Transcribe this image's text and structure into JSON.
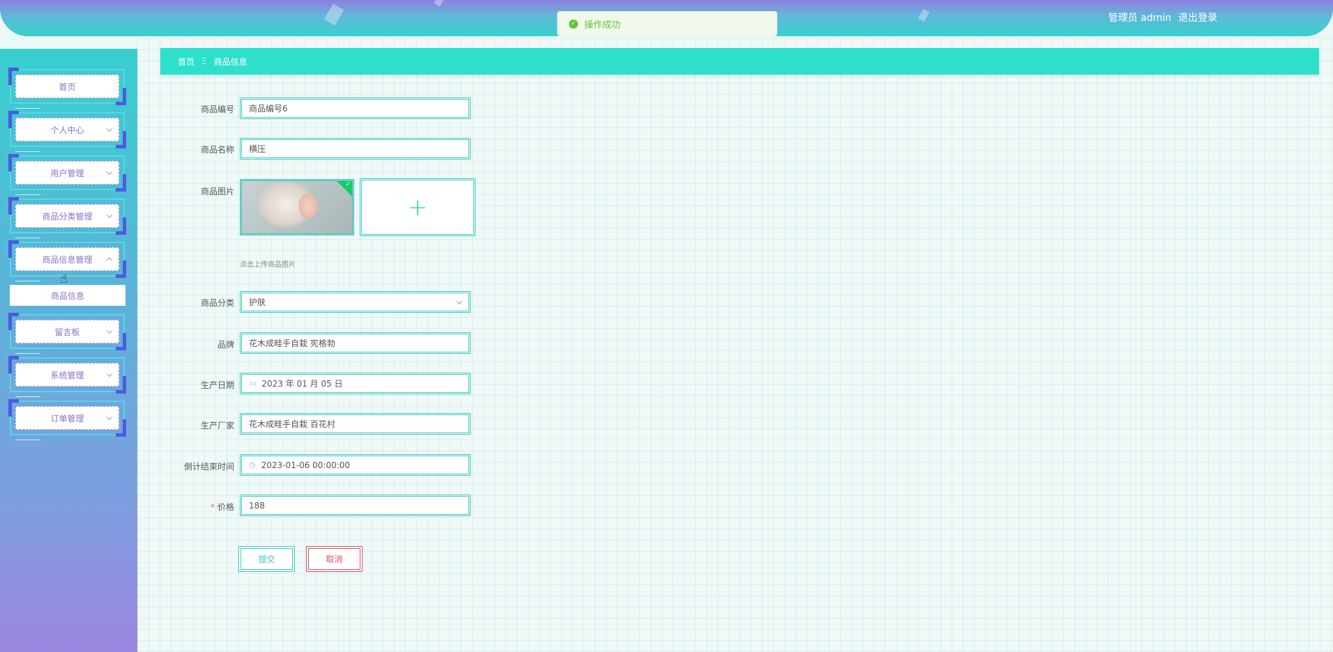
{
  "header": {
    "user_role": "管理员 admin",
    "logout_label": "退出登录"
  },
  "toast": {
    "message": "操作成功"
  },
  "sidebar": {
    "items": [
      {
        "label": "首页"
      },
      {
        "label": "个人中心"
      },
      {
        "label": "用户管理"
      },
      {
        "label": "商品分类管理"
      },
      {
        "label": "商品信息管理"
      },
      {
        "label": "留言板"
      },
      {
        "label": "系统管理"
      },
      {
        "label": "订单管理"
      }
    ],
    "submenu": {
      "label": "商品信息"
    }
  },
  "breadcrumb": {
    "home": "首页",
    "separator": "Ξ",
    "current": "商品信息"
  },
  "form": {
    "code_label": "商品编号",
    "code_value": "商品编号6",
    "name_label": "商品名称",
    "name_value": "横压",
    "image_label": "商品图片",
    "image_tip": "点击上传商品图片",
    "category_label": "商品分类",
    "category_value": "护肤",
    "brand_label": "品牌",
    "brand_value": "花木成畦手自栽 宪格勃",
    "date_label": "生产日期",
    "date_value": "2023 年 01 月 05 日",
    "maker_label": "生产厂家",
    "maker_value": "花木成畦手自栽 百花村",
    "countdown_label": "倒计结束时间",
    "countdown_value": "2023-01-06 00:00:00",
    "price_required": "*",
    "price_label": "价格",
    "price_value": "188",
    "submit_label": "提交",
    "cancel_label": "取消"
  },
  "colors": {
    "accent": "#39c8c2",
    "breadcrumb_bg": "#2edfcc",
    "danger": "#e0505a",
    "success": "#67c23a"
  }
}
